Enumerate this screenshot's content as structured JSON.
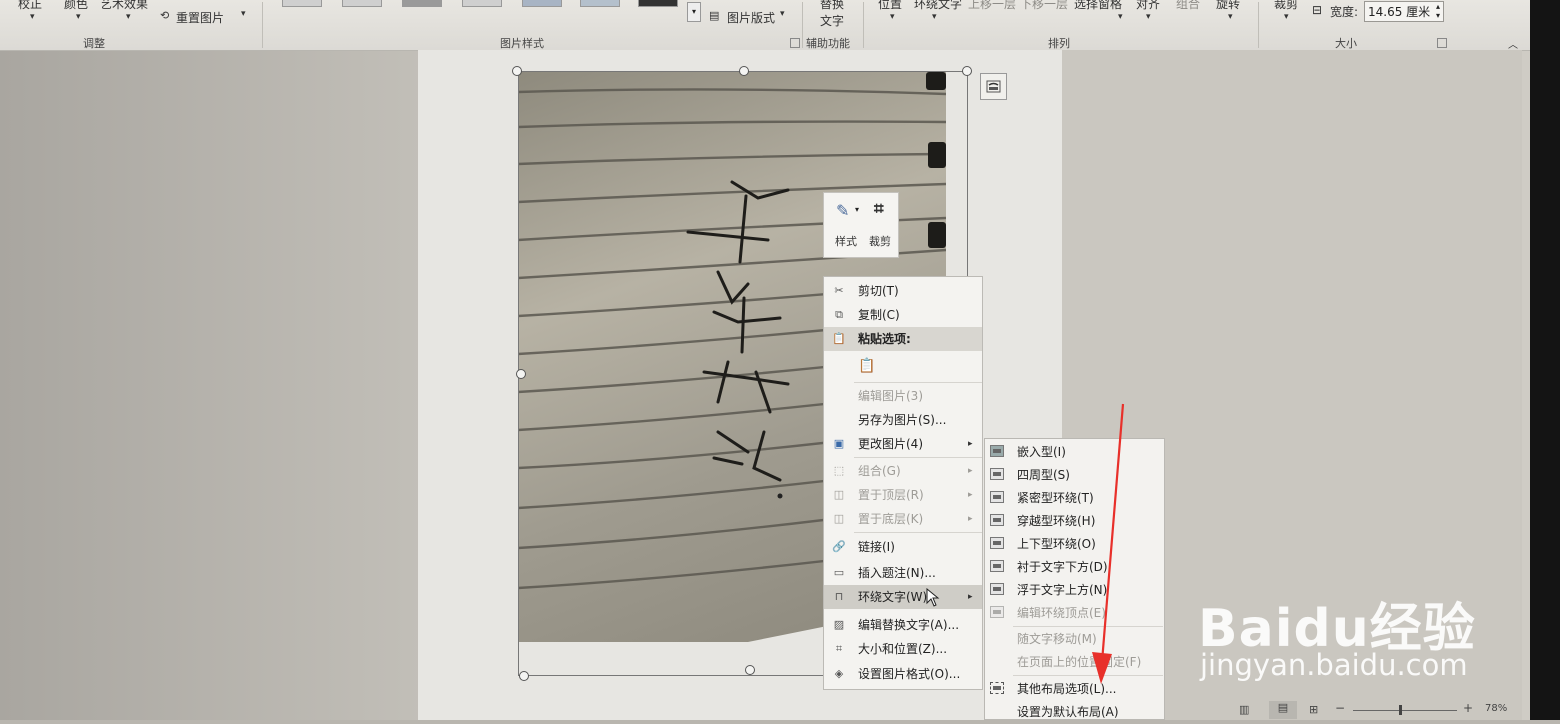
{
  "ribbon": {
    "top_labels": {
      "jiaozheng": "校正",
      "yanse": "颜色",
      "yishu": "艺术效果",
      "chongzhi": "重置图片",
      "banshi": "图片版式",
      "tihuan_1": "替换",
      "tihuan_2": "文字",
      "weizhi": "位置",
      "huanrao": "环绕文字",
      "shangyi": "上移一层",
      "xiayi": "下移一层",
      "xuanze": "选择窗格",
      "duiqi": "对齐",
      "zuhe": "组合",
      "xuanzhuan": "旋转",
      "caijian": "裁剪",
      "kuandu": "宽度:",
      "kuandu_value": "14.65 厘米"
    },
    "groups": {
      "tiaozheng": "调整",
      "tupianyangshi": "图片样式",
      "fuzhu": "辅助功能",
      "pailie": "排列",
      "daxiao": "大小"
    }
  },
  "mini_toolbar": {
    "style_label": "样式",
    "crop_label": "裁剪"
  },
  "context_menu": [
    {
      "label": "剪切(T)",
      "icon": "scissors-icon",
      "enabled": true
    },
    {
      "label": "复制(C)",
      "icon": "copy-icon",
      "enabled": true
    },
    {
      "label": "粘贴选项:",
      "icon": "paste-icon",
      "enabled": true
    },
    {
      "label": "编辑图片(3)",
      "icon": "",
      "enabled": false
    },
    {
      "label": "另存为图片(S)...",
      "icon": "",
      "enabled": true
    },
    {
      "label": "更改图片(4)",
      "icon": "change-picture-icon",
      "enabled": true
    },
    {
      "label": "组合(G)",
      "icon": "group-icon",
      "enabled": false
    },
    {
      "label": "置于顶层(R)",
      "icon": "bring-front-icon",
      "enabled": false
    },
    {
      "label": "置于底层(K)",
      "icon": "send-back-icon",
      "enabled": false
    },
    {
      "label": "链接(I)",
      "icon": "link-icon",
      "enabled": true
    },
    {
      "label": "插入题注(N)...",
      "icon": "caption-icon",
      "enabled": true
    },
    {
      "label": "环绕文字(W)",
      "icon": "wrap-text-icon",
      "enabled": true
    },
    {
      "label": "编辑替换文字(A)...",
      "icon": "alt-text-icon",
      "enabled": true
    },
    {
      "label": "大小和位置(Z)...",
      "icon": "size-position-icon",
      "enabled": true
    },
    {
      "label": "设置图片格式(O)...",
      "icon": "format-picture-icon",
      "enabled": true
    }
  ],
  "wrap_submenu": [
    {
      "label": "嵌入型(I)",
      "enabled": true
    },
    {
      "label": "四周型(S)",
      "enabled": true
    },
    {
      "label": "紧密型环绕(T)",
      "enabled": true
    },
    {
      "label": "穿越型环绕(H)",
      "enabled": true
    },
    {
      "label": "上下型环绕(O)",
      "enabled": true
    },
    {
      "label": "衬于文字下方(D)",
      "enabled": true
    },
    {
      "label": "浮于文字上方(N)",
      "enabled": true
    },
    {
      "label": "编辑环绕顶点(E)",
      "enabled": false
    },
    {
      "label": "随文字移动(M)",
      "enabled": false
    },
    {
      "label": "在页面上的位置固定(F)",
      "enabled": false
    },
    {
      "label": "其他布局选项(L)...",
      "enabled": true
    },
    {
      "label": "设置为默认布局(A)",
      "enabled": true
    }
  ],
  "statusbar": {
    "zoom": "78%"
  },
  "watermark": {
    "line1": "Baidu经验",
    "line2": "jingyan.baidu.com"
  },
  "colors": {
    "arrow": "#e8302a",
    "menu_bg": "#f4f3f0",
    "highlight": "#d8d6d0"
  }
}
